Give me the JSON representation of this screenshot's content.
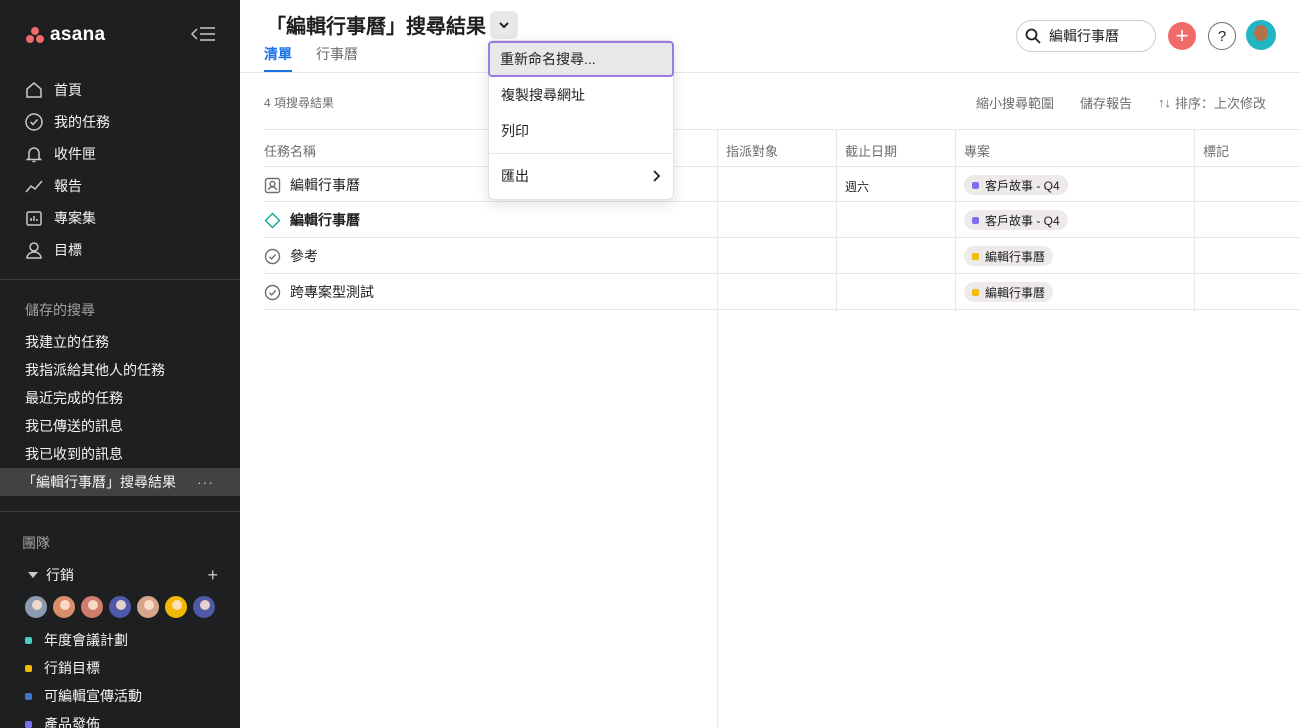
{
  "app": {
    "name": "asana"
  },
  "sidebar": {
    "nav": [
      {
        "label": "首頁",
        "icon": "home-icon"
      },
      {
        "label": "我的任務",
        "icon": "check-circle-icon"
      },
      {
        "label": "收件匣",
        "icon": "bell-icon"
      },
      {
        "label": "報告",
        "icon": "line-chart-icon"
      },
      {
        "label": "專案集",
        "icon": "portfolio-icon"
      },
      {
        "label": "目標",
        "icon": "person-icon"
      }
    ],
    "saved_searches_title": "儲存的搜尋",
    "saved_searches": [
      "我建立的任務",
      "我指派給其他人的任務",
      "最近完成的任務",
      "我已傳送的訊息",
      "我已收到的訊息",
      "「編輯行事曆」搜尋結果"
    ],
    "saved_more": "···",
    "teams_title": "團隊",
    "team_name": "行銷",
    "team_add": "+",
    "team_avatar_colors": [
      "#8c9bb0",
      "#d98e6a",
      "#cf7d6e",
      "#4e5aa8",
      "#d6a58a",
      "#f2b705",
      "#4e5aa8"
    ],
    "projects": [
      {
        "label": "年度會議計劃",
        "color": "#4ecbc4"
      },
      {
        "label": "行銷目標",
        "color": "#f1bd00"
      },
      {
        "label": "可編輯宣傳活動",
        "color": "#4573d2"
      },
      {
        "label": "產品發佈",
        "color": "#7a6ff0"
      }
    ]
  },
  "header": {
    "title": "「編輯行事曆」搜尋結果",
    "tabs": [
      "清單",
      "行事曆"
    ],
    "search_value": "編輯行事曆",
    "add_label": "+",
    "help_label": "?"
  },
  "toolbar": {
    "results_count": "4 項搜尋結果",
    "refine": "縮小搜尋範圍",
    "save_report": "儲存報告",
    "sort_icon": "↑↓",
    "sort": "排序：上次修改"
  },
  "table": {
    "headers": [
      "任務名稱",
      "指派對象",
      "截止日期",
      "專案",
      "標記"
    ],
    "rows": [
      {
        "name": "編輯行事曆",
        "icon": "approval-icon",
        "bold": false,
        "due": "週六",
        "project": "客戶故事 - Q4",
        "project_color": "#7a6ff0"
      },
      {
        "name": "編輯行事曆",
        "icon": "milestone-icon",
        "bold": true,
        "due": "",
        "project": "客戶故事 - Q4",
        "project_color": "#7a6ff0"
      },
      {
        "name": "參考",
        "icon": "check-circle-icon",
        "bold": false,
        "due": "",
        "project": "編輯行事曆",
        "project_color": "#f1bd00"
      },
      {
        "name": "跨專案型測試",
        "icon": "check-circle-icon",
        "bold": false,
        "due": "",
        "project": "編輯行事曆",
        "project_color": "#f1bd00"
      }
    ]
  },
  "menu": {
    "items": [
      "重新命名搜尋...",
      "複製搜尋網址",
      "列印",
      "匯出"
    ]
  },
  "colors": {
    "sidebar_bg": "#1e1f21",
    "accent_tab": "#1a73e8",
    "add_button": "#f06a6a",
    "menu_focus": "#9b7be6"
  }
}
